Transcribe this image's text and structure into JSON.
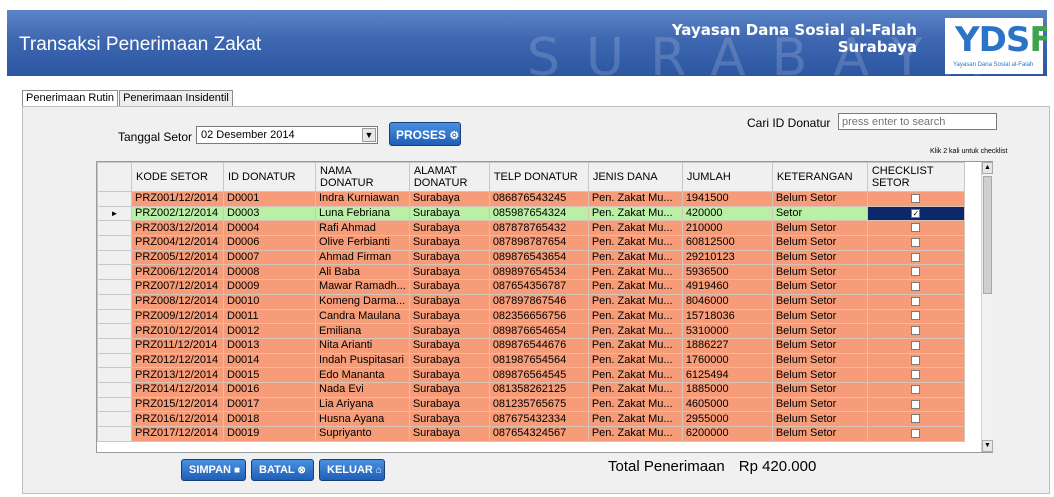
{
  "header": {
    "title": "Transaksi Penerimaan Zakat",
    "watermark": "SURABAYA",
    "org_line1": "Yayasan Dana Sosial al-Falah",
    "org_line2": "Surabaya",
    "logo_text_main": "YDS",
    "logo_text_accent": "F",
    "logo_subtitle": "Yayasan Dana Sosial al-Falah",
    "accent_color": "#2c56a3"
  },
  "tabs": [
    {
      "label": "Penerimaan Rutin",
      "active": true
    },
    {
      "label": "Penerimaan Insidentil",
      "active": false
    }
  ],
  "form": {
    "tanggal_label": "Tanggal Setor",
    "tanggal_value": "02 Desember 2014",
    "proses_label": "PROSES",
    "cari_label": "Cari ID Donatur",
    "cari_placeholder": "press enter to search",
    "hint": "Klik 2 kali untuk checklist"
  },
  "grid": {
    "columns": [
      "KODE SETOR",
      "ID DONATUR",
      "NAMA DONATUR",
      "ALAMAT DONATUR",
      "TELP DONATUR",
      "JENIS DANA",
      "JUMLAH",
      "KETERANGAN",
      "CHECKLIST SETOR"
    ],
    "rows": [
      {
        "kode": "PRZ001/12/2014",
        "id": "D0001",
        "nama": "Indra Kurniawan",
        "alamat": "Surabaya",
        "telp": "086876543245",
        "jenis": "Pen. Zakat Mu...",
        "jumlah": "1941500",
        "ket": "Belum Setor",
        "checked": false,
        "selected": false
      },
      {
        "kode": "PRZ002/12/2014",
        "id": "D0003",
        "nama": "Luna Febriana",
        "alamat": "Surabaya",
        "telp": "085987654324",
        "jenis": "Pen. Zakat Mu...",
        "jumlah": "420000",
        "ket": "Setor",
        "checked": true,
        "selected": true
      },
      {
        "kode": "PRZ003/12/2014",
        "id": "D0004",
        "nama": "Rafi Ahmad",
        "alamat": "Surabaya",
        "telp": "087878765432",
        "jenis": "Pen. Zakat Mu...",
        "jumlah": "210000",
        "ket": "Belum Setor",
        "checked": false,
        "selected": false
      },
      {
        "kode": "PRZ004/12/2014",
        "id": "D0006",
        "nama": "Olive Ferbianti",
        "alamat": "Surabaya",
        "telp": "087898787654",
        "jenis": "Pen. Zakat Mu...",
        "jumlah": "60812500",
        "ket": "Belum Setor",
        "checked": false,
        "selected": false
      },
      {
        "kode": "PRZ005/12/2014",
        "id": "D0007",
        "nama": "Ahmad Firman",
        "alamat": "Surabaya",
        "telp": "089876543654",
        "jenis": "Pen. Zakat Mu...",
        "jumlah": "29210123",
        "ket": "Belum Setor",
        "checked": false,
        "selected": false
      },
      {
        "kode": "PRZ006/12/2014",
        "id": "D0008",
        "nama": "Ali Baba",
        "alamat": "Surabaya",
        "telp": "089897654534",
        "jenis": "Pen. Zakat Mu...",
        "jumlah": "5936500",
        "ket": "Belum Setor",
        "checked": false,
        "selected": false
      },
      {
        "kode": "PRZ007/12/2014",
        "id": "D0009",
        "nama": "Mawar Ramadh...",
        "alamat": "Surabaya",
        "telp": "087654356787",
        "jenis": "Pen. Zakat Mu...",
        "jumlah": "4919460",
        "ket": "Belum Setor",
        "checked": false,
        "selected": false
      },
      {
        "kode": "PRZ008/12/2014",
        "id": "D0010",
        "nama": "Komeng Darma...",
        "alamat": "Surabaya",
        "telp": "087897867546",
        "jenis": "Pen. Zakat Mu...",
        "jumlah": "8046000",
        "ket": "Belum Setor",
        "checked": false,
        "selected": false
      },
      {
        "kode": "PRZ009/12/2014",
        "id": "D0011",
        "nama": "Candra Maulana",
        "alamat": "Surabaya",
        "telp": "082356656756",
        "jenis": "Pen. Zakat Mu...",
        "jumlah": "15718036",
        "ket": "Belum Setor",
        "checked": false,
        "selected": false
      },
      {
        "kode": "PRZ010/12/2014",
        "id": "D0012",
        "nama": "Emiliana",
        "alamat": "Surabaya",
        "telp": "089876654654",
        "jenis": "Pen. Zakat Mu...",
        "jumlah": "5310000",
        "ket": "Belum Setor",
        "checked": false,
        "selected": false
      },
      {
        "kode": "PRZ011/12/2014",
        "id": "D0013",
        "nama": "Nita Arianti",
        "alamat": "Surabaya",
        "telp": "089876544676",
        "jenis": "Pen. Zakat Mu...",
        "jumlah": "1886227",
        "ket": "Belum Setor",
        "checked": false,
        "selected": false
      },
      {
        "kode": "PRZ012/12/2014",
        "id": "D0014",
        "nama": "Indah Puspitasari",
        "alamat": "Surabaya",
        "telp": "081987654564",
        "jenis": "Pen. Zakat Mu...",
        "jumlah": "1760000",
        "ket": "Belum Setor",
        "checked": false,
        "selected": false
      },
      {
        "kode": "PRZ013/12/2014",
        "id": "D0015",
        "nama": "Edo Mananta",
        "alamat": "Surabaya",
        "telp": "089876564545",
        "jenis": "Pen. Zakat Mu...",
        "jumlah": "6125494",
        "ket": "Belum Setor",
        "checked": false,
        "selected": false
      },
      {
        "kode": "PRZ014/12/2014",
        "id": "D0016",
        "nama": "Nada Evi",
        "alamat": "Surabaya",
        "telp": "081358262125",
        "jenis": "Pen. Zakat Mu...",
        "jumlah": "1885000",
        "ket": "Belum Setor",
        "checked": false,
        "selected": false
      },
      {
        "kode": "PRZ015/12/2014",
        "id": "D0017",
        "nama": "Lia Ariyana",
        "alamat": "Surabaya",
        "telp": "081235765675",
        "jenis": "Pen. Zakat Mu...",
        "jumlah": "4605000",
        "ket": "Belum Setor",
        "checked": false,
        "selected": false
      },
      {
        "kode": "PRZ016/12/2014",
        "id": "D0018",
        "nama": "Husna Ayana",
        "alamat": "Surabaya",
        "telp": "087675432334",
        "jenis": "Pen. Zakat Mu...",
        "jumlah": "2955000",
        "ket": "Belum Setor",
        "checked": false,
        "selected": false
      },
      {
        "kode": "PRZ017/12/2014",
        "id": "D0019",
        "nama": "Supriyanto",
        "alamat": "Surabaya",
        "telp": "087654324567",
        "jenis": "Pen. Zakat Mu...",
        "jumlah": "6200000",
        "ket": "Belum Setor",
        "checked": false,
        "selected": false
      }
    ],
    "row_color": "#f79c78",
    "selected_row_color": "#b9f0a6",
    "selected_indicator": "►"
  },
  "buttons": {
    "simpan": "SIMPAN",
    "batal": "BATAL",
    "keluar": "KELUAR"
  },
  "total": {
    "label": "Total Penerimaan",
    "value": "Rp 420.000"
  }
}
